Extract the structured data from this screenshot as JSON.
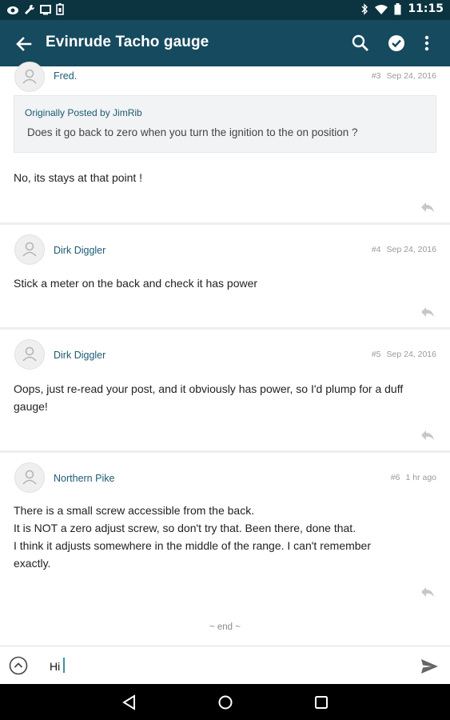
{
  "status_bar": {
    "time": "11:15",
    "left_icons": [
      "eye-icon",
      "wrench-icon",
      "screen-icon",
      "battery-saver-icon"
    ],
    "right_icons": [
      "bluetooth-icon",
      "wifi-icon",
      "battery-icon"
    ]
  },
  "app_bar": {
    "title": "Evinrude Tacho gauge",
    "background": "#164a5e",
    "icons": [
      "back-arrow-icon",
      "search-icon",
      "check-circle-icon",
      "more-vert-icon"
    ]
  },
  "posts": [
    {
      "author": "Fred.",
      "number": "#3",
      "time": "Sep 24, 2016",
      "quote": {
        "header": "Originally Posted by JimRib",
        "text": "Does it go back to zero when you turn the ignition to the on position ?"
      },
      "body": "No, its stays at that point !"
    },
    {
      "author": "Dirk Diggler",
      "number": "#4",
      "time": "Sep 24, 2016",
      "body": "Stick a meter on the back and check it has power"
    },
    {
      "author": "Dirk Diggler",
      "number": "#5",
      "time": "Sep 24, 2016",
      "body_lines": [
        "Oops, just re-read your post, and it obviously has power, so I'd plump for a duff",
        "gauge!"
      ]
    },
    {
      "author": "Northern Pike",
      "number": "#6",
      "time": "1 hr ago",
      "body_lines": [
        "There is a small screw accessible from the back.",
        "It is NOT a zero adjust screw, so don't try that. Been there, done that.",
        "I think it adjusts somewhere in the middle of the range. I can't remember",
        "exactly."
      ]
    }
  ],
  "end_marker": "~ end ~",
  "composer": {
    "value": "Hi",
    "icons": [
      "expand-up-icon",
      "send-icon"
    ]
  },
  "nav_bar": {
    "icons": [
      "nav-back-icon",
      "nav-home-icon",
      "nav-recents-icon"
    ]
  },
  "colors": {
    "status_bar": "#0b3340",
    "accent": "#1d5b73",
    "page_background": "#eeeeee"
  }
}
